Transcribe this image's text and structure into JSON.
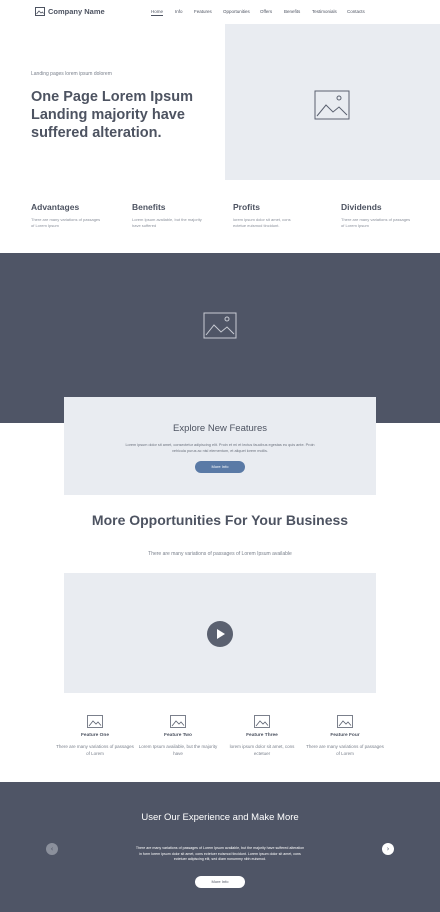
{
  "brand": {
    "name": "Company Name",
    "logo_icon": "image-icon"
  },
  "nav": [
    {
      "label": "Home",
      "active": true
    },
    {
      "label": "Info"
    },
    {
      "label": "Features"
    },
    {
      "label": "Opportunities"
    },
    {
      "label": "Offers"
    },
    {
      "label": "Benefits"
    },
    {
      "label": "Testimonials"
    },
    {
      "label": "Contacts"
    }
  ],
  "hero": {
    "subtitle": "Landing pages lorem ipsum dolorem",
    "title": "One Page Lorem Ipsum Landing majority have suffered alteration.",
    "image_icon": "image-placeholder-icon"
  },
  "columns": [
    {
      "title": "Advantages",
      "text": "There are many variations of passages of Lorem Ipsum"
    },
    {
      "title": "Benefits",
      "text": "Lorem Ipsum available, but the majority have suffered"
    },
    {
      "title": "Profits",
      "text": "lorem ipsum dolor sit amet, cons ectetue euismod tincidunt."
    },
    {
      "title": "Dividends",
      "text": "There are many variations of passages of Lorem Ipsum"
    }
  ],
  "explore": {
    "title": "Explore New Features",
    "text": "Lorem ipsum dolor sit amet, consectetur adipiscing elit. Proin et mi et lectus faucibus egestas eu quis ante. Proin vehicula purus ac nisl elementum, et aliquet lorem mollis.",
    "button": "More Info"
  },
  "opportunities": {
    "title": "More Opportunities For Your Business",
    "subtitle": "There are many variations of passages of Lorem Ipsum available"
  },
  "video": {
    "play_icon": "play-icon"
  },
  "features": [
    {
      "title": "Feature One",
      "text": "There are many variations of passages of Lorem"
    },
    {
      "title": "Feature Two",
      "text": "Lorem Ipsum available, but the majority have"
    },
    {
      "title": "Feature Three",
      "text": "lorem ipsum dolor sit amet, cons ectetuer"
    },
    {
      "title": "Feature Four",
      "text": "There are many variations of passages of Lorem"
    }
  ],
  "testimonials": {
    "title": "User Our Experience and Make More",
    "text": "There are many variations of passages of Lorem Ipsum available, but the majority have suffered alteration in form lorem ipsum dolor sit amet, cons ectetuer euismod tincidunt. Lorem ipsum dolor sit amet, cons ectetuer adipiscing elit, sed diam nonummy nibh euismod.",
    "button": "More Info",
    "prev_icon": "chevron-left-icon",
    "next_icon": "chevron-right-icon"
  },
  "colors": {
    "text": "#4d5361",
    "placeholder_bg": "#e9ecf1",
    "dark_band": "#4f5566",
    "accent_button": "#5a7aa6"
  }
}
